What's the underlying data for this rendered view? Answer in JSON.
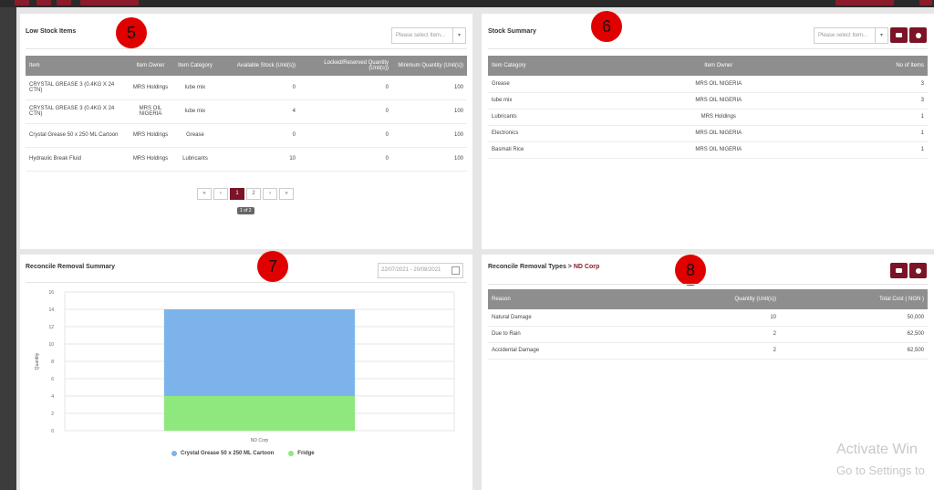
{
  "colors": {
    "brand": "#7a1426",
    "header": "#8e8e8e",
    "series_a": "#7db3eb",
    "series_b": "#8ee87d",
    "badge": "#e00000"
  },
  "low_stock": {
    "title": "Low Stock Items",
    "badge": "5",
    "select_placeholder": "Please select Item...",
    "columns": [
      "Item",
      "Item Owner",
      "Item Category",
      "Available Stock (Unit(s))",
      "Locked/Reserved Quantity (Unit(s))",
      "Minimum Quantity (Unit(s))"
    ],
    "rows": [
      [
        "CRYSTAL GREASE 3 (0.4KG X 24 CTN)",
        "MRS Holdings",
        "lube mix",
        "0",
        "0",
        "100"
      ],
      [
        "CRYSTAL GREASE 3 (0.4KG X 24 CTN)",
        "MRS OIL NIGERIA",
        "lube mix",
        "4",
        "0",
        "100"
      ],
      [
        "Crystal Grease 50 x 250 ML Cartoon",
        "MRS Holdings",
        "Grease",
        "0",
        "0",
        "100"
      ],
      [
        "Hydraulic Break Fluid",
        "MRS Holdings",
        "Lubricants",
        "10",
        "0",
        "100"
      ]
    ],
    "pager": [
      "«",
      "‹",
      "1",
      "2",
      "›",
      "»"
    ],
    "page_info": "1 of 2"
  },
  "stock_summary": {
    "title": "Stock Summary",
    "badge": "6",
    "select_placeholder": "Please select Item...",
    "columns": [
      "Item Category",
      "Item Owner",
      "No of Items"
    ],
    "rows": [
      [
        "Grease",
        "MRS OIL NIGERIA",
        "3"
      ],
      [
        "lube mix",
        "MRS OIL NIGERIA",
        "3"
      ],
      [
        "Lubricants",
        "MRS Holdings",
        "1"
      ],
      [
        "Electronics",
        "MRS OIL NIGERIA",
        "1"
      ],
      [
        "Basmati Rice",
        "MRS OIL NIGERIA",
        "1"
      ]
    ],
    "icons": [
      "list-icon",
      "settings-icon"
    ]
  },
  "reconcile_summary": {
    "title": "Reconcile Removal Summary",
    "badge": "7",
    "date_range": "22/07/2021 - 20/08/2021"
  },
  "reconcile_types": {
    "title_prefix": "Reconcile Removal Types >",
    "title_accent": "ND Corp",
    "badge": "8",
    "columns": [
      "Reason",
      "Quantity (Unit(s))",
      "Total Cost ( NGN )"
    ],
    "rows": [
      [
        "Natural Damage",
        "10",
        "50,000"
      ],
      [
        "Due to Rain",
        "2",
        "62,500"
      ],
      [
        "Accidental Damage",
        "2",
        "62,500"
      ]
    ]
  },
  "chart_data": {
    "type": "bar",
    "stacked": true,
    "categories": [
      "ND Corp"
    ],
    "series": [
      {
        "name": "Crystal Grease 50 x 250 ML Cartoon",
        "values": [
          10
        ]
      },
      {
        "name": "Fridge",
        "values": [
          4
        ]
      }
    ],
    "ylabel": "Quantity",
    "xlabel": "",
    "ylim": [
      0,
      16
    ],
    "yticks": [
      "0",
      "2",
      "4",
      "6",
      "8",
      "10",
      "12",
      "14",
      "16"
    ],
    "grid": true,
    "legend": "bottom"
  },
  "watermark": {
    "line1": "Activate Win",
    "line2": "Go to Settings to"
  }
}
